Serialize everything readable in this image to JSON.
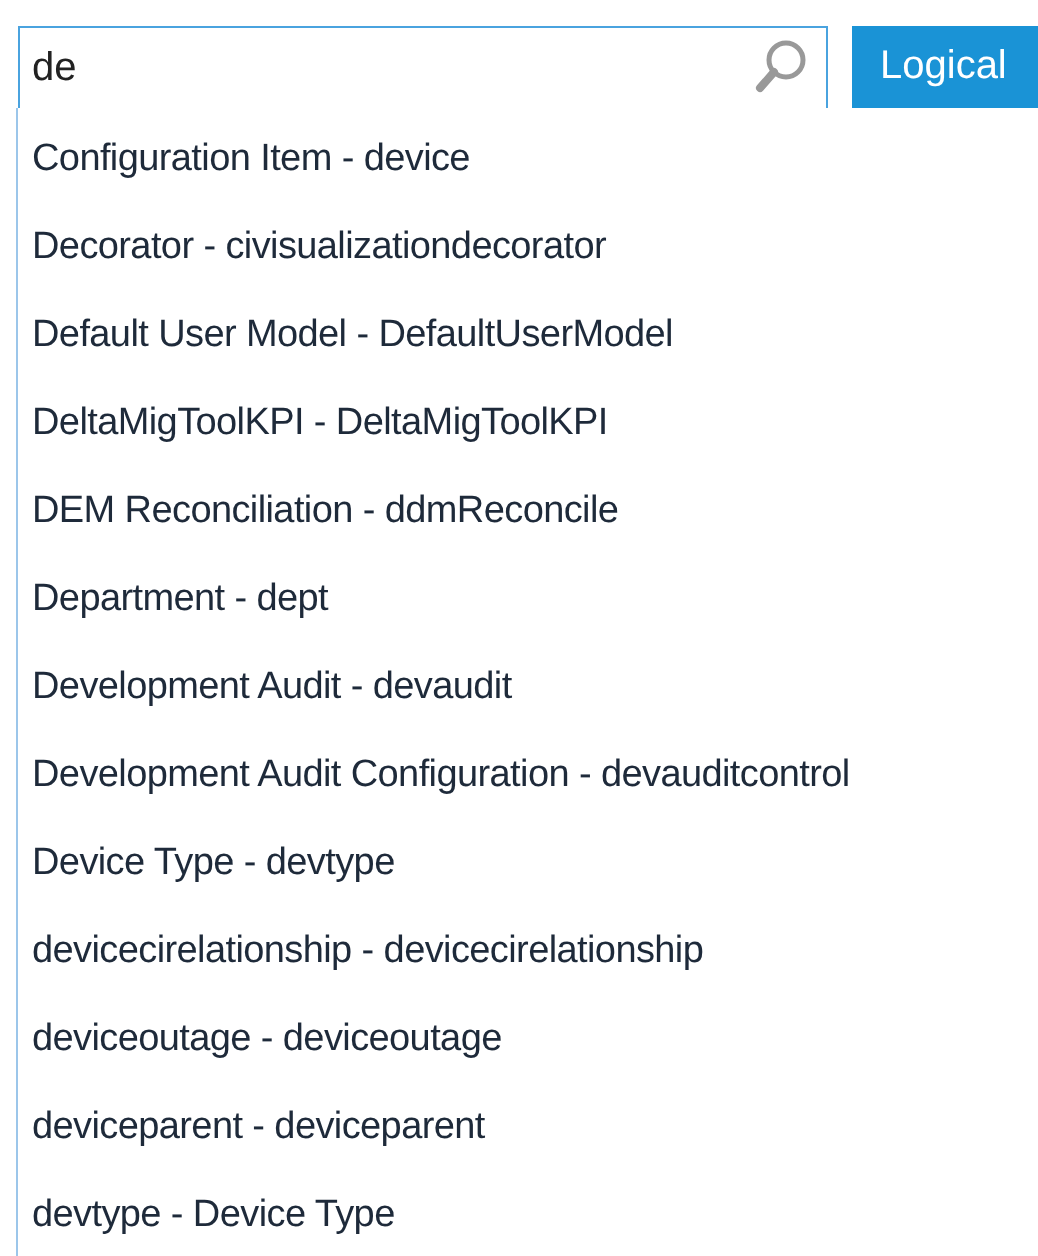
{
  "search": {
    "value": "de"
  },
  "mode_button": {
    "label": "Logical"
  },
  "suggestions": [
    {
      "label": "Configuration Item - device"
    },
    {
      "label": "Decorator - civisualizationdecorator"
    },
    {
      "label": "Default User Model - DefaultUserModel"
    },
    {
      "label": "DeltaMigToolKPI - DeltaMigToolKPI"
    },
    {
      "label": "DEM Reconciliation - ddmReconcile"
    },
    {
      "label": "Department - dept"
    },
    {
      "label": "Development Audit - devaudit"
    },
    {
      "label": "Development Audit Configuration - devauditcontrol"
    },
    {
      "label": "Device Type - devtype"
    },
    {
      "label": "devicecirelationship - devicecirelationship"
    },
    {
      "label": "deviceoutage - deviceoutage"
    },
    {
      "label": "deviceparent - deviceparent"
    },
    {
      "label": "devtype - Device Type"
    }
  ]
}
